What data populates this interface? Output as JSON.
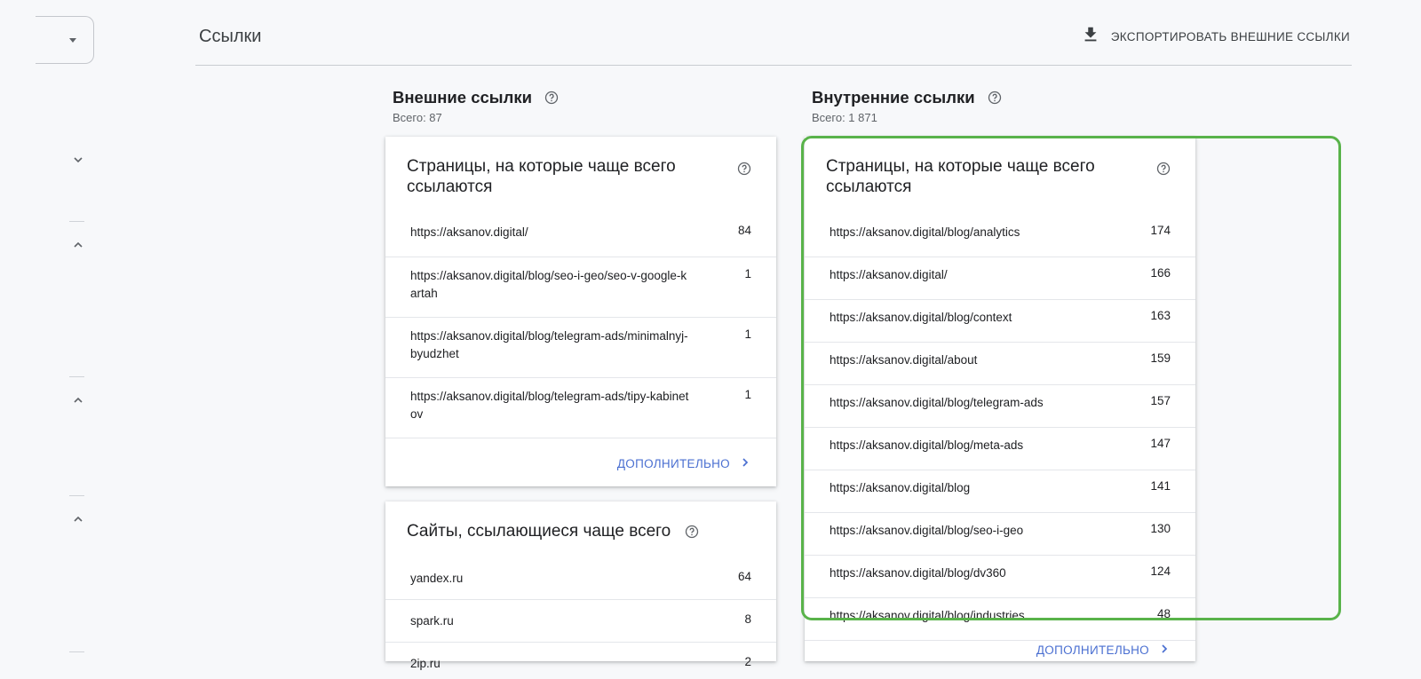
{
  "header": {
    "title": "Ссылки",
    "export_label": "ЭКСПОРТИРОВАТЬ ВНЕШНИЕ ССЫЛКИ"
  },
  "external": {
    "heading": "Внешние ссылки",
    "total": "Всего: 87",
    "top_pages": {
      "title": "Страницы, на которые чаще всего ссылаются",
      "rows": [
        {
          "url": "https://aksanov.digital/",
          "count": "84"
        },
        {
          "url": "https://aksanov.digital/blog/seo-i-geo/seo-v-google-kartah",
          "count": "1"
        },
        {
          "url": "https://aksanov.digital/blog/telegram-ads/minimalnyj-byudzhet",
          "count": "1"
        },
        {
          "url": "https://aksanov.digital/blog/telegram-ads/tipy-kabinetov",
          "count": "1"
        }
      ],
      "more_label": "ДОПОЛНИТЕЛЬНО"
    },
    "top_sites": {
      "title": "Сайты, ссылающиеся чаще всего",
      "rows": [
        {
          "url": "yandex.ru",
          "count": "64"
        },
        {
          "url": "spark.ru",
          "count": "8"
        },
        {
          "url": "2ip.ru",
          "count": "2"
        }
      ]
    }
  },
  "internal": {
    "heading": "Внутренние ссылки",
    "total": "Всего: 1 871",
    "top_pages": {
      "title": "Страницы, на которые чаще всего ссылаются",
      "rows": [
        {
          "url": "https://aksanov.digital/blog/analytics",
          "count": "174"
        },
        {
          "url": "https://aksanov.digital/",
          "count": "166"
        },
        {
          "url": "https://aksanov.digital/blog/context",
          "count": "163"
        },
        {
          "url": "https://aksanov.digital/about",
          "count": "159"
        },
        {
          "url": "https://aksanov.digital/blog/telegram-ads",
          "count": "157"
        },
        {
          "url": "https://aksanov.digital/blog/meta-ads",
          "count": "147"
        },
        {
          "url": "https://aksanov.digital/blog",
          "count": "141"
        },
        {
          "url": "https://aksanov.digital/blog/seo-i-geo",
          "count": "130"
        },
        {
          "url": "https://aksanov.digital/blog/dv360",
          "count": "124"
        },
        {
          "url": "https://aksanov.digital/blog/industries",
          "count": "48"
        }
      ],
      "more_label": "ДОПОЛНИТЕЛЬНО"
    }
  },
  "colors": {
    "accent": "#4a6fd1",
    "highlight": "#59b34a"
  }
}
